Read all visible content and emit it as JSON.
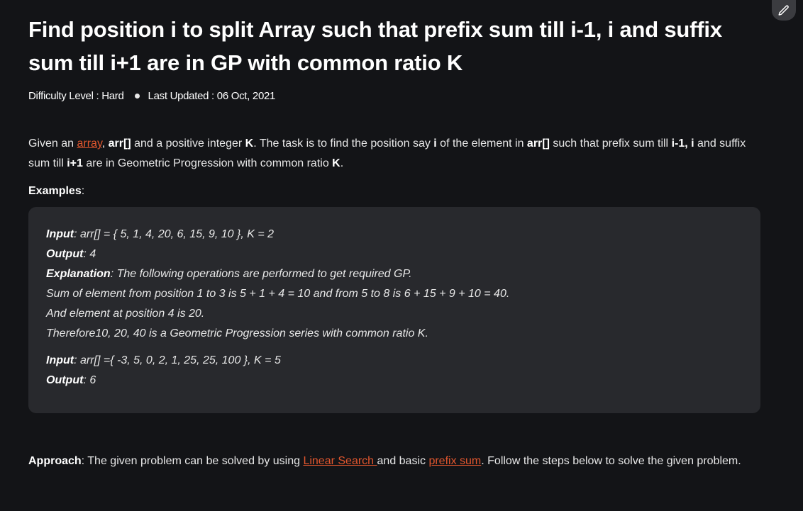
{
  "edit_icon": "pencil-icon",
  "title": "Find position i to split Array such that prefix sum till i-1, i and suffix sum till i+1 are in GP with common ratio K",
  "meta": {
    "difficulty": "Difficulty Level : Hard",
    "last_updated": "Last Updated : 06 Oct, 2021"
  },
  "intro": {
    "t1": "Given an ",
    "link_array": "array",
    "t2": ", ",
    "b_arr": "arr[]",
    "t3": " and a positive integer ",
    "b_k": "K",
    "t4": ". The task is to find the position say ",
    "b_i": "i",
    "t5": " of the element in ",
    "b_arr2": "arr[]",
    "t6": " such that prefix sum till ",
    "b_im1": "i-1, i",
    "t7": " and suffix sum till ",
    "b_ip1": "i+1",
    "t8": " are in Geometric Progression with common ratio ",
    "b_k2": "K",
    "t9": "."
  },
  "examples_heading": {
    "label": "Examples",
    "colon": ":"
  },
  "example1": {
    "input_label": "Input",
    "input_value": ": arr[] = { 5, 1, 4, 20, 6, 15, 9, 10 }, K = 2",
    "output_label": "Output",
    "output_value": ": 4",
    "explanation_label": "Explanation",
    "explanation_value": ":  The following operations are performed to get required GP.",
    "line4": "Sum of element from position 1 to 3 is 5 + 1 + 4 = 10 and from 5 to 8 is 6 + 15 + 9 + 10 = 40.",
    "line5": "And element at position 4 is 20.",
    "line6": "Therefore10, 20, 40 is a Geometric Progression series with common ratio K."
  },
  "example2": {
    "input_label": "Input",
    "input_value": ": arr[] ={ -3, 5, 0, 2, 1, 25, 25, 100 }, K = 5",
    "output_label": "Output",
    "output_value": ": 6"
  },
  "approach": {
    "label": "Approach",
    "t1": ":  The given problem can be solved by using ",
    "link_linear": "Linear Search ",
    "t2": "and basic ",
    "link_prefix": "prefix sum",
    "t3": ". Follow the steps below to solve the given problem."
  },
  "colors": {
    "background": "#131417",
    "code_background": "#28292d",
    "link": "#e0562e"
  }
}
